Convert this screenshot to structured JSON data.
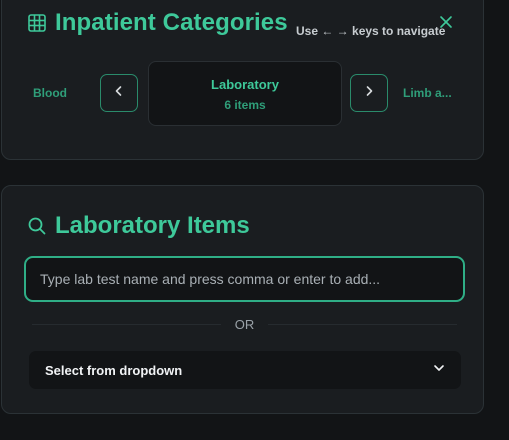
{
  "categories_panel": {
    "title": "Inpatient Categories",
    "nav_hint": "Use ← → keys to navigate",
    "prev_category": "Blood",
    "next_category": "Limb a...",
    "current": {
      "name": "Laboratory",
      "count": "6 items"
    },
    "icons": {
      "header": "grid-icon",
      "close": "close-icon",
      "prev": "chevron-left-icon",
      "next": "chevron-right-icon"
    }
  },
  "lab_panel": {
    "title": "Laboratory Items",
    "input_placeholder": "Type lab test name and press comma or enter to add...",
    "input_value": "",
    "divider_text": "OR",
    "dropdown_label": "Select from dropdown",
    "icons": {
      "header": "search-icon",
      "dropdown": "chevron-down-icon"
    }
  },
  "colors": {
    "accent": "#3ec99a",
    "accent_dim": "#2f9e79",
    "background": "#121416",
    "card": "#1a1d20"
  }
}
